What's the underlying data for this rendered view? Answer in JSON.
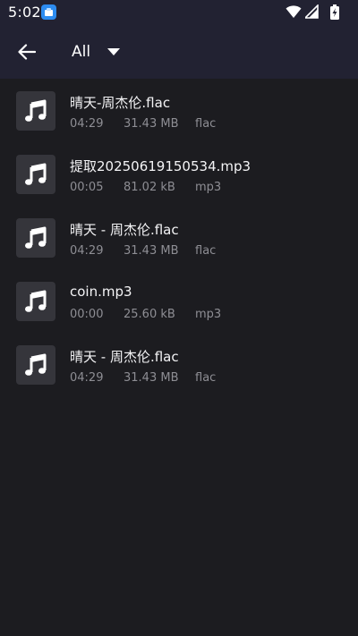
{
  "status_bar": {
    "time": "5:02",
    "icons": [
      "app-notification-icon",
      "wifi-icon",
      "cellular-signal-icon",
      "battery-charging-icon"
    ]
  },
  "toolbar": {
    "back_icon": "arrow-left-icon",
    "filter_label": "All",
    "filter_icon": "dropdown-caret-icon"
  },
  "colors": {
    "background": "#1c1c20",
    "toolbar_background": "#222232",
    "thumbnail_background": "#35353b",
    "primary_text": "#f4f4f6",
    "secondary_text": "#8e8e94"
  },
  "files": [
    {
      "name": "晴天-周杰伦.flac",
      "duration": "04:29",
      "size": "31.43 MB",
      "format": "flac",
      "icon": "music-note-icon"
    },
    {
      "name": "提取20250619150534.mp3",
      "duration": "00:05",
      "size": "81.02 kB",
      "format": "mp3",
      "icon": "music-note-icon"
    },
    {
      "name": "晴天 - 周杰伦.flac",
      "duration": "04:29",
      "size": "31.43 MB",
      "format": "flac",
      "icon": "music-note-icon"
    },
    {
      "name": "coin.mp3",
      "duration": "00:00",
      "size": "25.60 kB",
      "format": "mp3",
      "icon": "music-note-icon"
    },
    {
      "name": "晴天 - 周杰伦.flac",
      "duration": "04:29",
      "size": "31.43 MB",
      "format": "flac",
      "icon": "music-note-icon"
    }
  ]
}
